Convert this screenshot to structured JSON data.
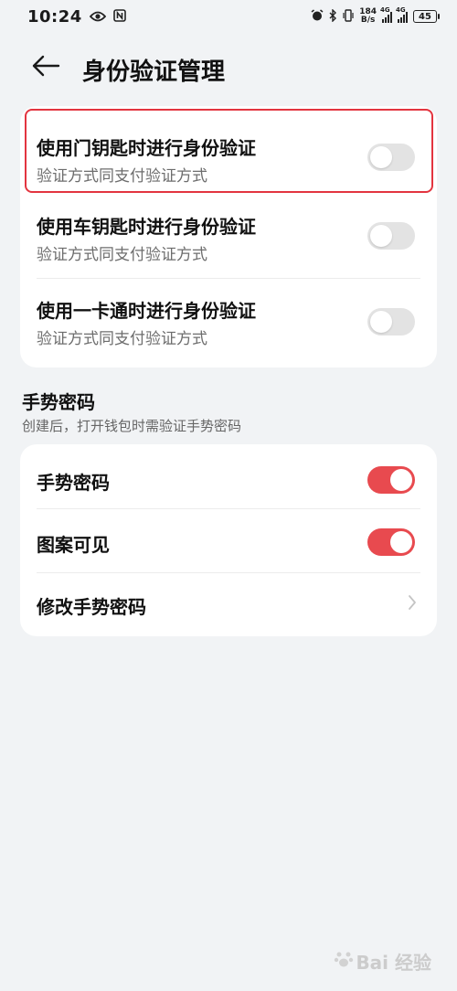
{
  "status_bar": {
    "time": "10:24",
    "speed_top": "184",
    "speed_bottom": "B/s",
    "sig1_tag": "4G",
    "sig2_tag": "4G",
    "battery": "45"
  },
  "header": {
    "title": "身份验证管理"
  },
  "auth_rows": [
    {
      "title": "使用门钥匙时进行身份验证",
      "subtitle": "验证方式同支付验证方式",
      "enabled": false
    },
    {
      "title": "使用车钥匙时进行身份验证",
      "subtitle": "验证方式同支付验证方式",
      "enabled": false
    },
    {
      "title": "使用一卡通时进行身份验证",
      "subtitle": "验证方式同支付验证方式",
      "enabled": false
    }
  ],
  "gesture_section": {
    "title": "手势密码",
    "subtitle": "创建后，打开钱包时需验证手势密码",
    "rows": [
      {
        "label": "手势密码",
        "enabled": true
      },
      {
        "label": "图案可见",
        "enabled": true
      },
      {
        "label": "修改手势密码"
      }
    ]
  },
  "colors": {
    "accent": "#e84a4f",
    "highlight": "#e3343f",
    "background": "#f1f3f5"
  },
  "watermark": "Bai 经验"
}
